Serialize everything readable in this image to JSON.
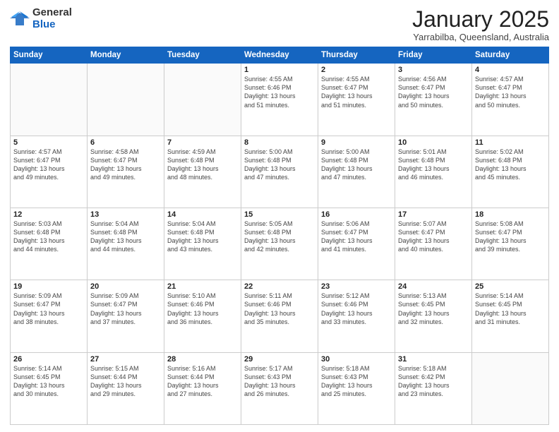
{
  "logo": {
    "general": "General",
    "blue": "Blue"
  },
  "header": {
    "month": "January 2025",
    "location": "Yarrabilba, Queensland, Australia"
  },
  "weekdays": [
    "Sunday",
    "Monday",
    "Tuesday",
    "Wednesday",
    "Thursday",
    "Friday",
    "Saturday"
  ],
  "weeks": [
    [
      {
        "day": "",
        "info": ""
      },
      {
        "day": "",
        "info": ""
      },
      {
        "day": "",
        "info": ""
      },
      {
        "day": "1",
        "info": "Sunrise: 4:55 AM\nSunset: 6:46 PM\nDaylight: 13 hours\nand 51 minutes."
      },
      {
        "day": "2",
        "info": "Sunrise: 4:55 AM\nSunset: 6:47 PM\nDaylight: 13 hours\nand 51 minutes."
      },
      {
        "day": "3",
        "info": "Sunrise: 4:56 AM\nSunset: 6:47 PM\nDaylight: 13 hours\nand 50 minutes."
      },
      {
        "day": "4",
        "info": "Sunrise: 4:57 AM\nSunset: 6:47 PM\nDaylight: 13 hours\nand 50 minutes."
      }
    ],
    [
      {
        "day": "5",
        "info": "Sunrise: 4:57 AM\nSunset: 6:47 PM\nDaylight: 13 hours\nand 49 minutes."
      },
      {
        "day": "6",
        "info": "Sunrise: 4:58 AM\nSunset: 6:47 PM\nDaylight: 13 hours\nand 49 minutes."
      },
      {
        "day": "7",
        "info": "Sunrise: 4:59 AM\nSunset: 6:48 PM\nDaylight: 13 hours\nand 48 minutes."
      },
      {
        "day": "8",
        "info": "Sunrise: 5:00 AM\nSunset: 6:48 PM\nDaylight: 13 hours\nand 47 minutes."
      },
      {
        "day": "9",
        "info": "Sunrise: 5:00 AM\nSunset: 6:48 PM\nDaylight: 13 hours\nand 47 minutes."
      },
      {
        "day": "10",
        "info": "Sunrise: 5:01 AM\nSunset: 6:48 PM\nDaylight: 13 hours\nand 46 minutes."
      },
      {
        "day": "11",
        "info": "Sunrise: 5:02 AM\nSunset: 6:48 PM\nDaylight: 13 hours\nand 45 minutes."
      }
    ],
    [
      {
        "day": "12",
        "info": "Sunrise: 5:03 AM\nSunset: 6:48 PM\nDaylight: 13 hours\nand 44 minutes."
      },
      {
        "day": "13",
        "info": "Sunrise: 5:04 AM\nSunset: 6:48 PM\nDaylight: 13 hours\nand 44 minutes."
      },
      {
        "day": "14",
        "info": "Sunrise: 5:04 AM\nSunset: 6:48 PM\nDaylight: 13 hours\nand 43 minutes."
      },
      {
        "day": "15",
        "info": "Sunrise: 5:05 AM\nSunset: 6:48 PM\nDaylight: 13 hours\nand 42 minutes."
      },
      {
        "day": "16",
        "info": "Sunrise: 5:06 AM\nSunset: 6:47 PM\nDaylight: 13 hours\nand 41 minutes."
      },
      {
        "day": "17",
        "info": "Sunrise: 5:07 AM\nSunset: 6:47 PM\nDaylight: 13 hours\nand 40 minutes."
      },
      {
        "day": "18",
        "info": "Sunrise: 5:08 AM\nSunset: 6:47 PM\nDaylight: 13 hours\nand 39 minutes."
      }
    ],
    [
      {
        "day": "19",
        "info": "Sunrise: 5:09 AM\nSunset: 6:47 PM\nDaylight: 13 hours\nand 38 minutes."
      },
      {
        "day": "20",
        "info": "Sunrise: 5:09 AM\nSunset: 6:47 PM\nDaylight: 13 hours\nand 37 minutes."
      },
      {
        "day": "21",
        "info": "Sunrise: 5:10 AM\nSunset: 6:46 PM\nDaylight: 13 hours\nand 36 minutes."
      },
      {
        "day": "22",
        "info": "Sunrise: 5:11 AM\nSunset: 6:46 PM\nDaylight: 13 hours\nand 35 minutes."
      },
      {
        "day": "23",
        "info": "Sunrise: 5:12 AM\nSunset: 6:46 PM\nDaylight: 13 hours\nand 33 minutes."
      },
      {
        "day": "24",
        "info": "Sunrise: 5:13 AM\nSunset: 6:45 PM\nDaylight: 13 hours\nand 32 minutes."
      },
      {
        "day": "25",
        "info": "Sunrise: 5:14 AM\nSunset: 6:45 PM\nDaylight: 13 hours\nand 31 minutes."
      }
    ],
    [
      {
        "day": "26",
        "info": "Sunrise: 5:14 AM\nSunset: 6:45 PM\nDaylight: 13 hours\nand 30 minutes."
      },
      {
        "day": "27",
        "info": "Sunrise: 5:15 AM\nSunset: 6:44 PM\nDaylight: 13 hours\nand 29 minutes."
      },
      {
        "day": "28",
        "info": "Sunrise: 5:16 AM\nSunset: 6:44 PM\nDaylight: 13 hours\nand 27 minutes."
      },
      {
        "day": "29",
        "info": "Sunrise: 5:17 AM\nSunset: 6:43 PM\nDaylight: 13 hours\nand 26 minutes."
      },
      {
        "day": "30",
        "info": "Sunrise: 5:18 AM\nSunset: 6:43 PM\nDaylight: 13 hours\nand 25 minutes."
      },
      {
        "day": "31",
        "info": "Sunrise: 5:18 AM\nSunset: 6:42 PM\nDaylight: 13 hours\nand 23 minutes."
      },
      {
        "day": "",
        "info": ""
      }
    ]
  ]
}
